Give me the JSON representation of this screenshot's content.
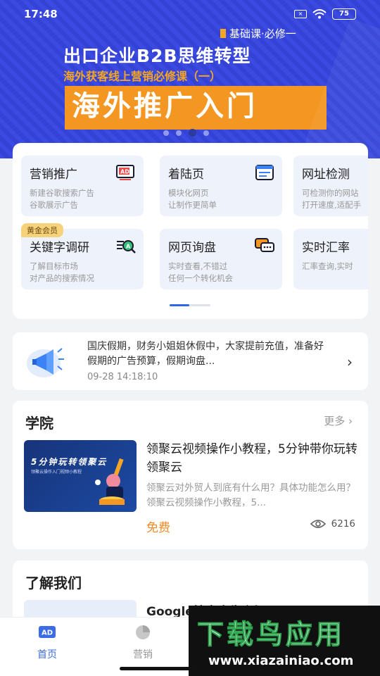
{
  "status": {
    "time": "17:48",
    "battery": "75"
  },
  "banner": {
    "badge": "基础课·必修一",
    "title": "出口企业B2B思维转型",
    "subtitle": "海外获客线上营销必修课（一）",
    "main": "海外推广入门",
    "accent_color": "#f39722",
    "slide_count": 4,
    "active_slide": 3
  },
  "tools": [
    {
      "title": "营销推广",
      "desc1": "新建谷歌搜索广告",
      "desc2": "谷歌展示广告",
      "icon": "ad-icon"
    },
    {
      "title": "着陆页",
      "desc1": "模块化网页",
      "desc2": "让制作更简单",
      "icon": "webpage-icon"
    },
    {
      "title": "网址检测",
      "desc1": "可检测你的网站",
      "desc2": "打开速度,适配手",
      "icon": "url-check-icon"
    },
    {
      "title": "关键字调研",
      "desc1": "了解目标市场",
      "desc2": "对产品的搜索情况",
      "icon": "keyword-icon",
      "tag": "黄金会员"
    },
    {
      "title": "网页询盘",
      "desc1": "实时查看,不错过",
      "desc2": "任何一个转化机会",
      "icon": "chat-icon"
    },
    {
      "title": "实时汇率",
      "desc1": "汇率查询,实时",
      "desc2": "",
      "icon": "exchange-icon"
    }
  ],
  "notice": {
    "text": "国庆假期，财务小姐姐休假中，大家提前充值，准备好假期的广告预算，假期询盘...",
    "time": "09-28 14:18:10"
  },
  "academy": {
    "title": "学院",
    "more": "更多",
    "course": {
      "thumb_title": "5分钟玩转领聚云",
      "thumb_sub": "领聚云操作入门视频小教程",
      "title": "领聚云视频操作小教程，5分钟带你玩转领聚云",
      "desc": "领聚云对外贸人到底有什么用？具体功能怎么用？领聚云视频操作小教程，5...",
      "price": "免费",
      "views": "6216"
    }
  },
  "about": {
    "title": "了解我们",
    "item_title": "Google搜索广告介绍"
  },
  "nav": [
    {
      "label": "首页",
      "icon": "home-ad-icon",
      "active": true
    },
    {
      "label": "营销",
      "icon": "pie-chart-icon",
      "active": false
    }
  ],
  "watermark": {
    "main": "下载鸟应用",
    "url": "www.xiazainiao.com"
  }
}
